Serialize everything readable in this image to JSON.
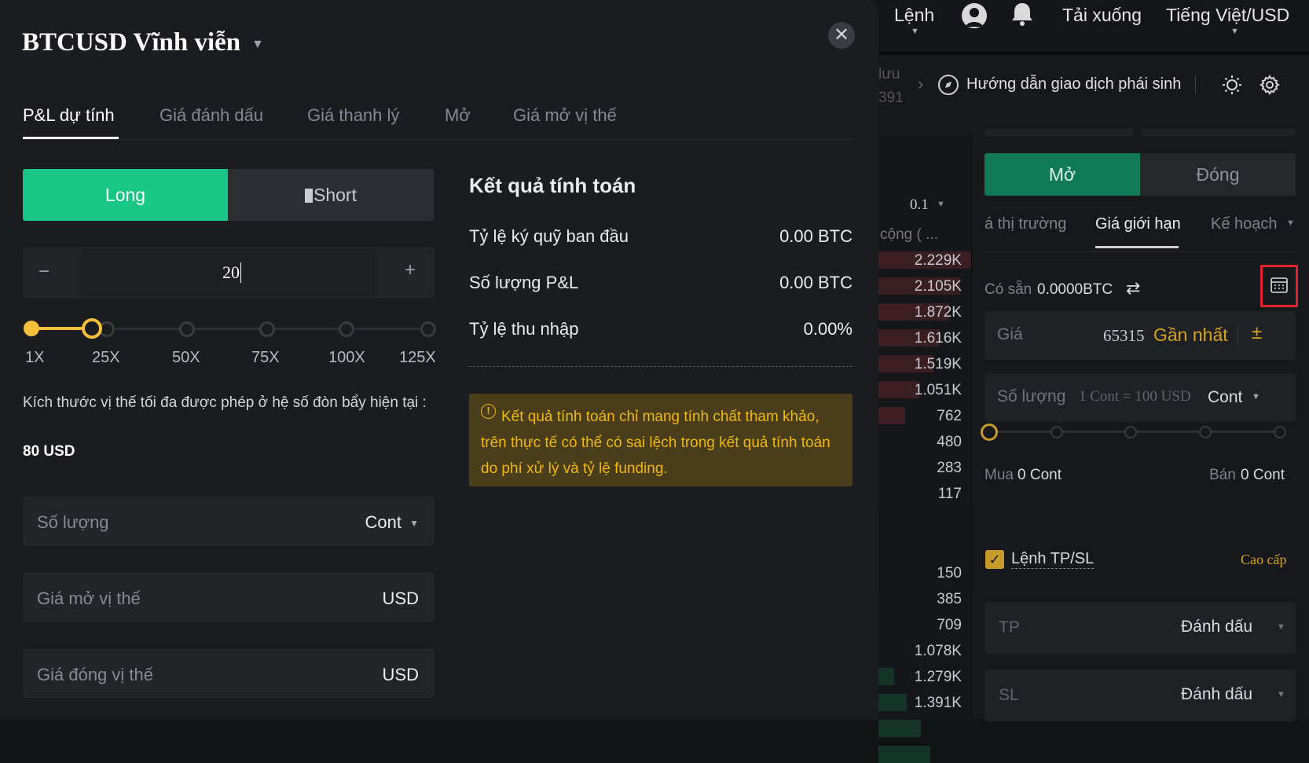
{
  "background": {
    "topnav": {
      "orders": "Lệnh",
      "download": "Tải xuống",
      "language": "Tiếng Việt/USD"
    },
    "subbar": {
      "partial_top": "lưu",
      "partial_bottom": "391",
      "guide": "Hướng dẫn giao dịch phái sinh"
    },
    "orderbook": {
      "precision": "0.1",
      "header": "cộng ( ...",
      "asks": [
        "2.229K",
        "2.105K",
        "1.872K",
        "1.616K",
        "1.519K",
        "1.051K",
        "762",
        "480",
        "283",
        "117"
      ],
      "bids": [
        "150",
        "385",
        "709",
        "1.078K",
        "1.279K",
        "1.391K"
      ]
    },
    "trade_form": {
      "open": "Mở",
      "close": "Đóng",
      "tab_market": "á thị trường",
      "tab_limit": "Giá giới hạn",
      "tab_plan": "Kế hoạch",
      "available_label": "Có sẵn",
      "available_value": "0.0000BTC",
      "price_label": "Giá",
      "price_value": "65315",
      "price_latest": "Gần nhất",
      "qty_label": "Số lượng",
      "qty_placeholder": "1 Cont = 100 USD",
      "qty_unit": "Cont",
      "buy_label": "Mua",
      "buy_value": "0 Cont",
      "sell_label": "Bán",
      "sell_value": "0 Cont",
      "tpsl_label": "Lệnh TP/SL",
      "advanced": "Cao cấp",
      "tp_label": "TP",
      "tp_mode": "Đánh dấu",
      "sl_label": "SL",
      "sl_mode": "Đánh dấu"
    }
  },
  "modal": {
    "title": "BTCUSD Vĩnh viễn",
    "tabs": [
      "P&L dự tính",
      "Giá đánh dấu",
      "Giá thanh lý",
      "Mở",
      "Giá mở vị thế"
    ],
    "active_tab": 0,
    "side": {
      "long": "Long",
      "short": "Short",
      "selected": "Long"
    },
    "leverage": {
      "value": "20",
      "minus": "−",
      "plus": "+",
      "marks": [
        "1X",
        "25X",
        "50X",
        "75X",
        "100X",
        "125X"
      ],
      "level_fraction": 0.153
    },
    "max_position_text": "Kích thước vị thế tối đa được phép ở hệ số đòn bẩy hiện tại :",
    "max_position_value": "80 USD",
    "fields": {
      "quantity": {
        "label": "Số lượng",
        "unit": "Cont"
      },
      "open_price": {
        "label": "Giá mở vị thế",
        "unit": "USD"
      },
      "close_price": {
        "label": "Giá đóng vị thế",
        "unit": "USD"
      }
    },
    "results": {
      "title": "Kết quả tính toán",
      "rows": [
        {
          "label": "Tỷ lệ ký quỹ ban đầu",
          "value": "0.00 BTC"
        },
        {
          "label": "Số lượng P&L",
          "value": "0.00 BTC"
        },
        {
          "label": "Tỷ lệ thu nhập",
          "value": "0.00%"
        }
      ],
      "notice": "Kết quả tính toán chỉ mang tính chất tham khảo, trên thực tế có thể có sai lệch trong kết quả tính toán do phí xử lý và tỷ lệ funding."
    }
  },
  "colors": {
    "green": "#16c784",
    "yellow": "#f0b90b",
    "red_highlight": "#e0242c",
    "notice_bg": "#4a3d1c"
  }
}
